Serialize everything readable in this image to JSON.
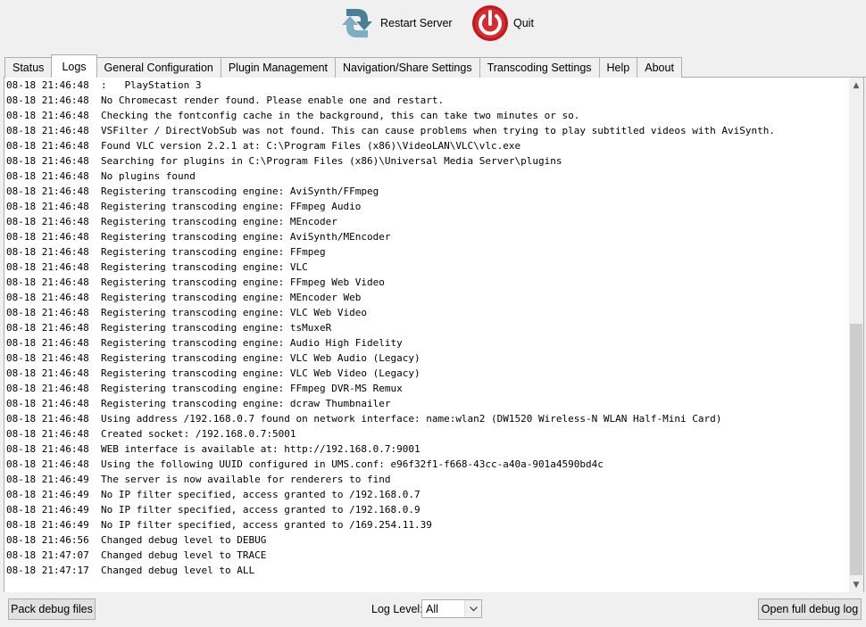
{
  "toolbar": {
    "restart_label": "Restart Server",
    "quit_label": "Quit"
  },
  "tabs": [
    {
      "label": "Status"
    },
    {
      "label": "Logs",
      "active": true
    },
    {
      "label": "General Configuration"
    },
    {
      "label": "Plugin Management"
    },
    {
      "label": "Navigation/Share Settings"
    },
    {
      "label": "Transcoding Settings"
    },
    {
      "label": "Help"
    },
    {
      "label": "About"
    }
  ],
  "log": {
    "lines": [
      "08-18 21:46:48  :   PlayStation 3",
      "08-18 21:46:48  No Chromecast render found. Please enable one and restart.",
      "08-18 21:46:48  Checking the fontconfig cache in the background, this can take two minutes or so.",
      "08-18 21:46:48  VSFilter / DirectVobSub was not found. This can cause problems when trying to play subtitled videos with AviSynth.",
      "08-18 21:46:48  Found VLC version 2.2.1 at: C:\\Program Files (x86)\\VideoLAN\\VLC\\vlc.exe",
      "08-18 21:46:48  Searching for plugins in C:\\Program Files (x86)\\Universal Media Server\\plugins",
      "08-18 21:46:48  No plugins found",
      "08-18 21:46:48  Registering transcoding engine: AviSynth/FFmpeg",
      "08-18 21:46:48  Registering transcoding engine: FFmpeg Audio",
      "08-18 21:46:48  Registering transcoding engine: MEncoder",
      "08-18 21:46:48  Registering transcoding engine: AviSynth/MEncoder",
      "08-18 21:46:48  Registering transcoding engine: FFmpeg",
      "08-18 21:46:48  Registering transcoding engine: VLC",
      "08-18 21:46:48  Registering transcoding engine: FFmpeg Web Video",
      "08-18 21:46:48  Registering transcoding engine: MEncoder Web",
      "08-18 21:46:48  Registering transcoding engine: VLC Web Video",
      "08-18 21:46:48  Registering transcoding engine: tsMuxeR",
      "08-18 21:46:48  Registering transcoding engine: Audio High Fidelity",
      "08-18 21:46:48  Registering transcoding engine: VLC Web Audio (Legacy)",
      "08-18 21:46:48  Registering transcoding engine: VLC Web Video (Legacy)",
      "08-18 21:46:48  Registering transcoding engine: FFmpeg DVR-MS Remux",
      "08-18 21:46:48  Registering transcoding engine: dcraw Thumbnailer",
      "08-18 21:46:48  Using address /192.168.0.7 found on network interface: name:wlan2 (DW1520 Wireless-N WLAN Half-Mini Card)",
      "08-18 21:46:48  Created socket: /192.168.0.7:5001",
      "08-18 21:46:48  WEB interface is available at: http://192.168.0.7:9001",
      "08-18 21:46:48  Using the following UUID configured in UMS.conf: e96f32f1-f668-43cc-a40a-901a4590bd4c",
      "08-18 21:46:49  The server is now available for renderers to find",
      "08-18 21:46:49  No IP filter specified, access granted to /192.168.0.7",
      "08-18 21:46:49  No IP filter specified, access granted to /192.168.0.9",
      "08-18 21:46:49  No IP filter specified, access granted to /169.254.11.39",
      "08-18 21:46:56  Changed debug level to DEBUG",
      "08-18 21:47:07  Changed debug level to TRACE",
      "08-18 21:47:17  Changed debug level to ALL"
    ]
  },
  "bottom": {
    "pack_label": "Pack debug files",
    "log_level_label": "Log Level:",
    "log_level_value": "All",
    "open_log_label": "Open full debug log"
  },
  "icons": {
    "restart": "restart-arrows-icon",
    "quit": "power-icon"
  },
  "colors": {
    "restart_icon": "#5b8fa3",
    "quit_icon": "#c0181d"
  }
}
